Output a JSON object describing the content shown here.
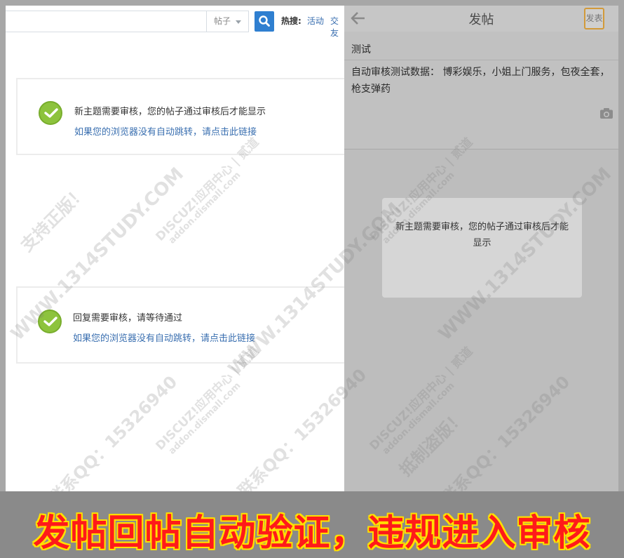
{
  "desktop": {
    "search_type": "帖子",
    "hot_label": "热搜:",
    "hot_links": [
      "活动",
      "交友"
    ],
    "notices": [
      {
        "message": "新主题需要审核，您的帖子通过审核后才能显示",
        "redirect_link": "如果您的浏览器没有自动跳转，请点击此链接"
      },
      {
        "message": "回复需要审核，请等待通过",
        "redirect_link": "如果您的浏览器没有自动跳转，请点击此链接"
      }
    ]
  },
  "mobile": {
    "title": "发帖",
    "submit_label": "发表",
    "subject": "测试",
    "content": "自动审核测试数据：  博彩娱乐，小姐上门服务，包夜全套，枪支弹药",
    "dialog_message": "新主题需要审核，您的帖子通过审核后才能显示"
  },
  "watermark": {
    "brand": "DISCUZ!应用中心 | 贰道",
    "domain": "addon.dismall.com",
    "site": "WWW.1314STUDY.COM",
    "contact": "联系QQ：15326940",
    "support": "支持正版！",
    "anti": "抵制盗版！"
  },
  "banner": {
    "text": "发帖回帖自动验证，违规进入审核"
  },
  "colors": {
    "link": "#3a6fb0",
    "check_green": "#8dc33d",
    "search_button": "#2f7fd0",
    "banner_red": "#ff1a1a",
    "banner_outline": "#ffe000",
    "submit_border": "#d29a3a"
  }
}
